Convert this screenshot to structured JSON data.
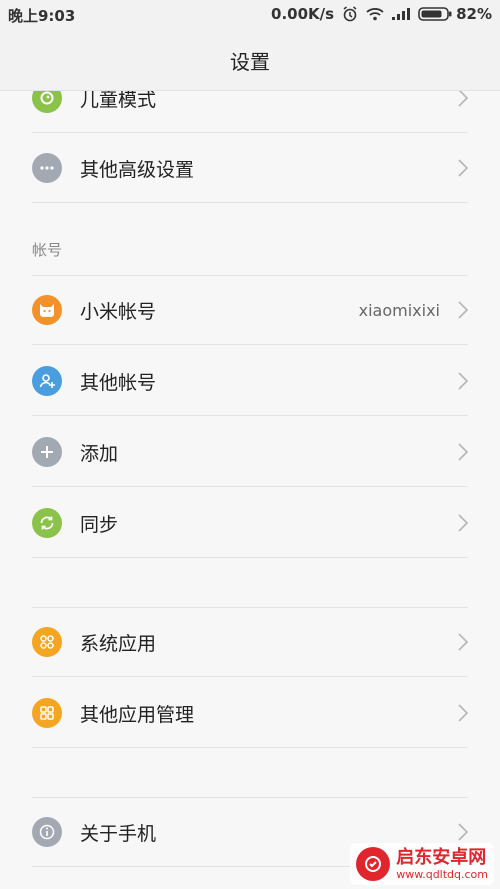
{
  "status_bar": {
    "time": "晚上9:03",
    "net_speed": "0.00K/s",
    "battery": "82%"
  },
  "title_bar": {
    "title": "设置"
  },
  "sections": {
    "advanced": {
      "items": [
        {
          "label": "儿童模式",
          "icon": "kid-mode-icon",
          "color": "#8ac24a"
        },
        {
          "label": "其他高级设置",
          "icon": "more-dots-icon",
          "color": "#a3a9b3"
        }
      ]
    },
    "account": {
      "header": "帐号",
      "items": [
        {
          "label": "小米帐号",
          "value": "xiaomixixi",
          "icon": "mi-account-icon",
          "color": "#f3922b"
        },
        {
          "label": "其他帐号",
          "icon": "add-person-icon",
          "color": "#4a9ee0"
        },
        {
          "label": "添加",
          "icon": "plus-icon",
          "color": "#a3a9b3"
        },
        {
          "label": "同步",
          "icon": "sync-icon",
          "color": "#8ac24a"
        }
      ]
    },
    "apps": {
      "items": [
        {
          "label": "系统应用",
          "icon": "system-apps-icon",
          "color": "#f4a623"
        },
        {
          "label": "其他应用管理",
          "icon": "app-manage-icon",
          "color": "#f4a623"
        }
      ]
    },
    "about": {
      "items": [
        {
          "label": "关于手机",
          "icon": "info-icon",
          "color": "#a3a9b3"
        }
      ]
    }
  },
  "watermark": {
    "title": "启东安卓网",
    "url": "www.qdltdq.com"
  }
}
